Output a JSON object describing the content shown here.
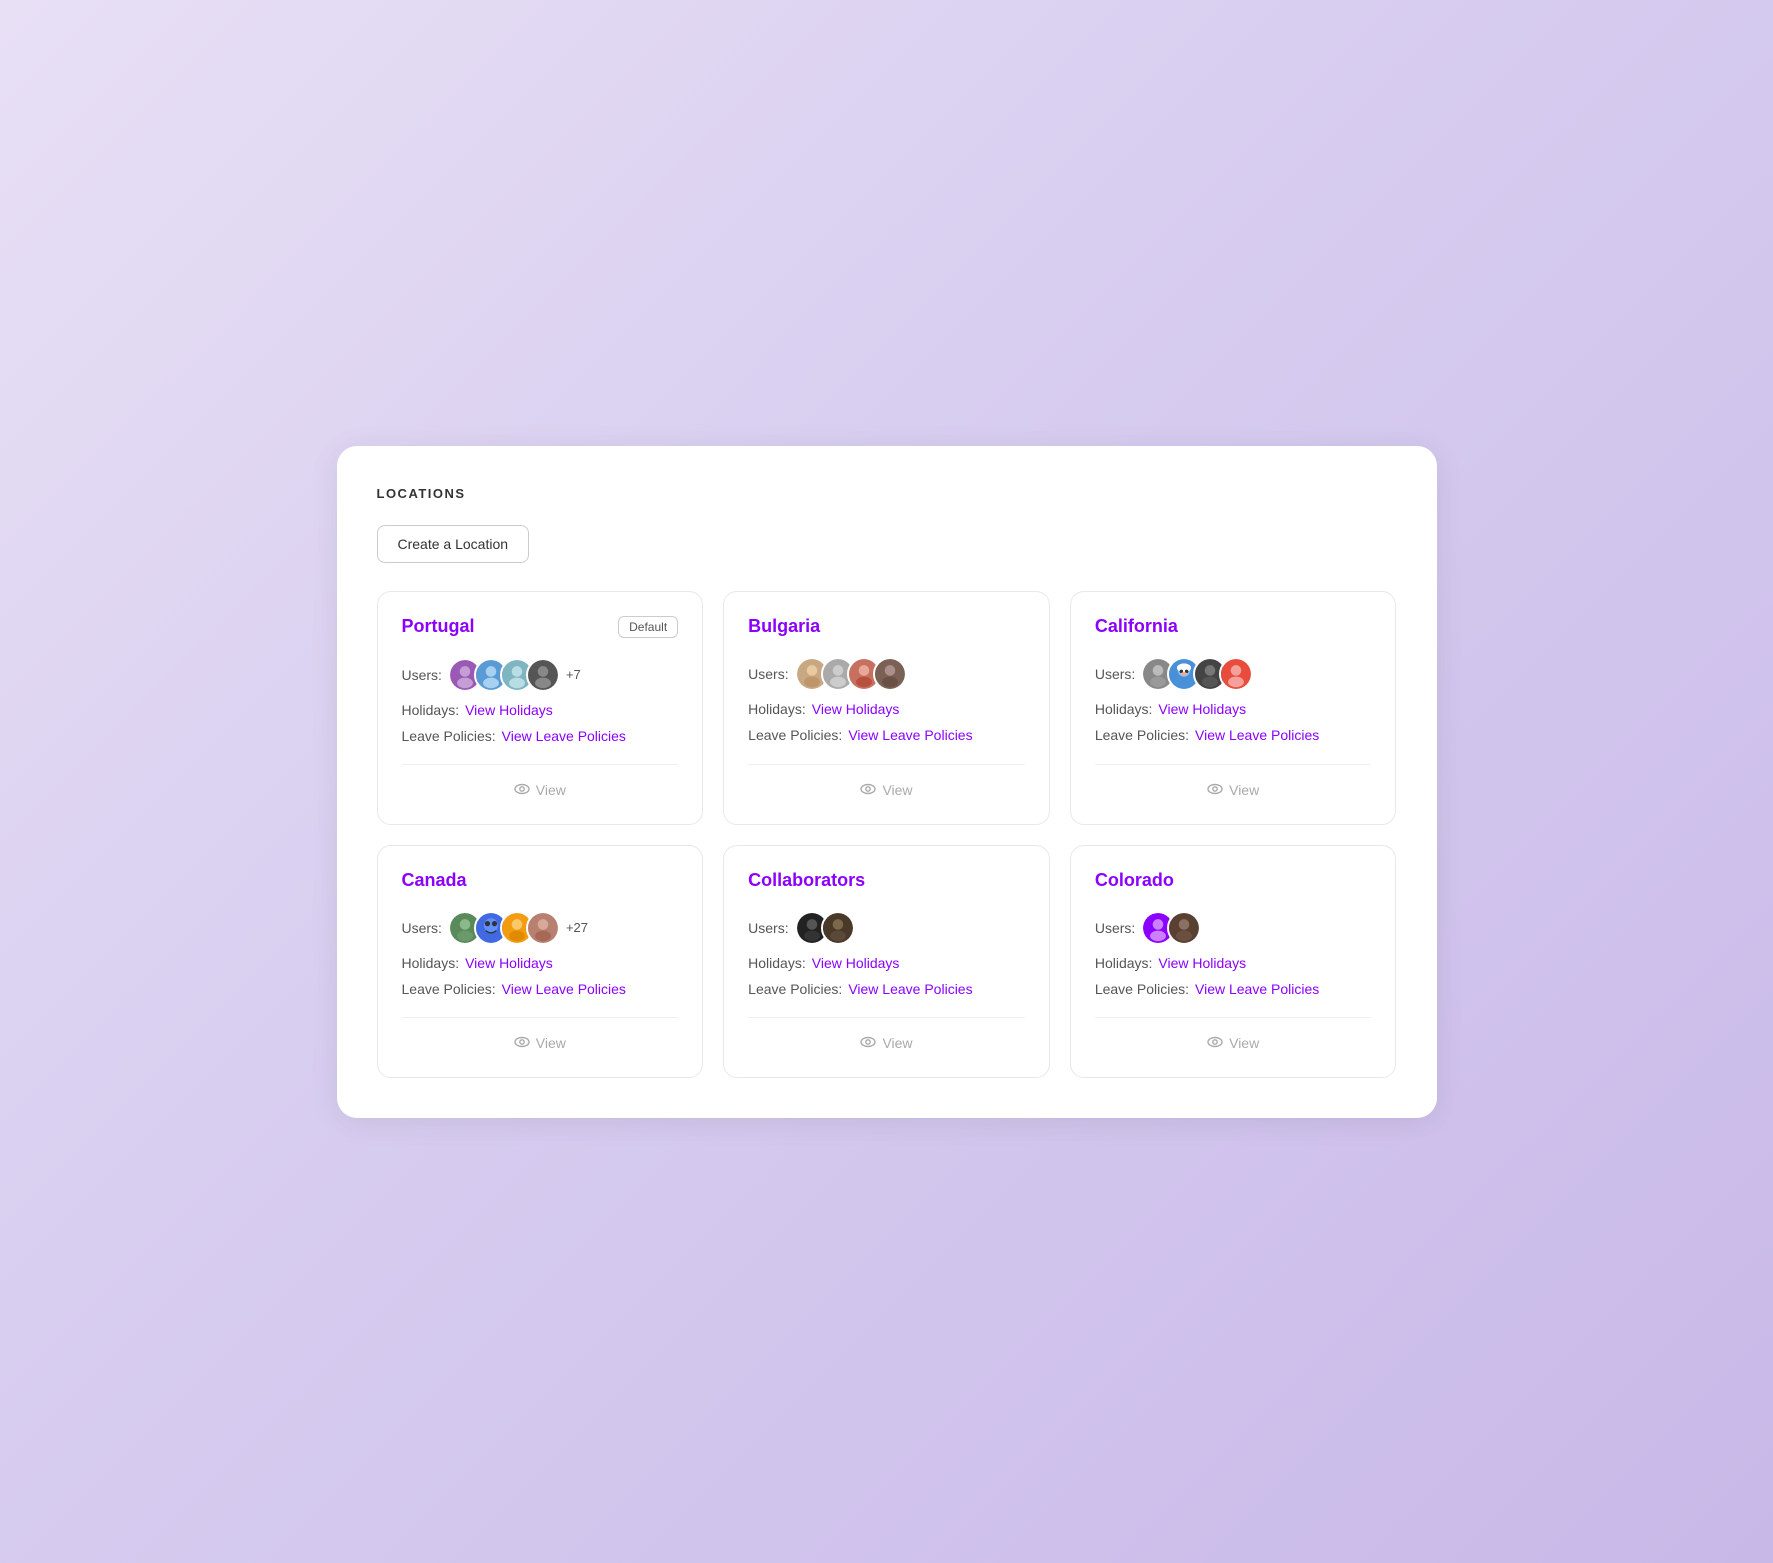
{
  "page": {
    "title": "LOCATIONS",
    "create_button": "Create a Location"
  },
  "locations": [
    {
      "name": "Portugal",
      "is_default": true,
      "default_label": "Default",
      "users_label": "Users:",
      "user_count_extra": "+7",
      "holidays_label": "Holidays:",
      "holidays_link": "View Holidays",
      "leave_label": "Leave Policies:",
      "leave_link": "View Leave Policies",
      "view_label": "View",
      "avatars": [
        "purple-user",
        "blue-user",
        "teal-user",
        "dark-user"
      ]
    },
    {
      "name": "Bulgaria",
      "is_default": false,
      "default_label": "",
      "users_label": "Users:",
      "user_count_extra": "",
      "holidays_label": "Holidays:",
      "holidays_link": "View Holidays",
      "leave_label": "Leave Policies:",
      "leave_link": "View Leave Policies",
      "view_label": "View",
      "avatars": [
        "person1",
        "gray-user",
        "person2",
        "person3"
      ]
    },
    {
      "name": "California",
      "is_default": false,
      "default_label": "",
      "users_label": "Users:",
      "user_count_extra": "",
      "holidays_label": "Holidays:",
      "holidays_link": "View Holidays",
      "leave_label": "Leave Policies:",
      "leave_link": "View Leave Policies",
      "view_label": "View",
      "avatars": [
        "bw-person",
        "smurf",
        "dark-person2",
        "red-user"
      ]
    },
    {
      "name": "Canada",
      "is_default": false,
      "default_label": "",
      "users_label": "Users:",
      "user_count_extra": "+27",
      "holidays_label": "Holidays:",
      "holidays_link": "View Holidays",
      "leave_label": "Leave Policies:",
      "leave_link": "View Leave Policies",
      "view_label": "View",
      "avatars": [
        "nature-person",
        "stitch",
        "orange-person",
        "photo-person"
      ]
    },
    {
      "name": "Collaborators",
      "is_default": false,
      "default_label": "",
      "users_label": "Users:",
      "user_count_extra": "",
      "holidays_label": "Holidays:",
      "holidays_link": "View Holidays",
      "leave_label": "Leave Policies:",
      "leave_link": "View Leave Policies",
      "view_label": "View",
      "avatars": [
        "dark-avatar1",
        "dark-avatar2"
      ]
    },
    {
      "name": "Colorado",
      "is_default": false,
      "default_label": "",
      "users_label": "Users:",
      "user_count_extra": "",
      "holidays_label": "Holidays:",
      "holidays_link": "View Holidays",
      "leave_label": "Leave Policies:",
      "leave_link": "View Leave Policies",
      "view_label": "View",
      "avatars": [
        "purple-user2",
        "dark-avatar3"
      ]
    }
  ]
}
